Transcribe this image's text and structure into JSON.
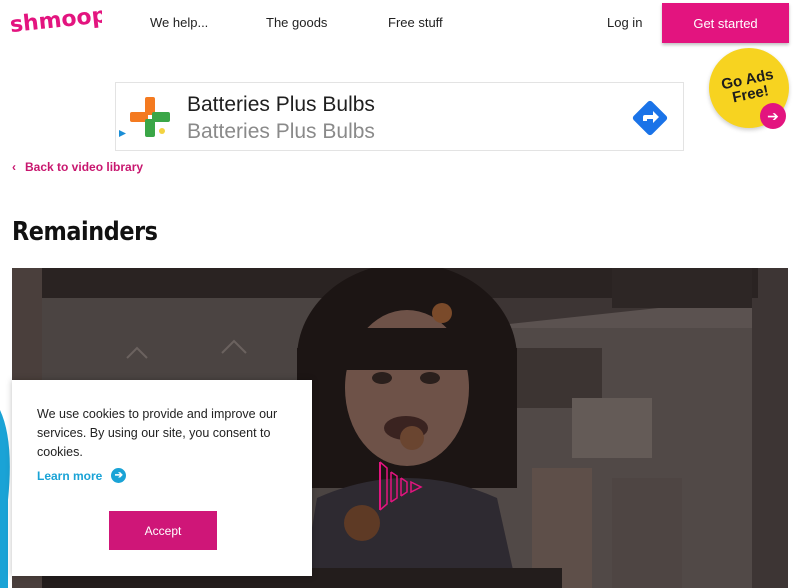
{
  "header": {
    "logo_text": "shmoop",
    "nav": [
      "We help...",
      "The goods",
      "Free stuff"
    ],
    "login_label": "Log in",
    "cta_label": "Get started"
  },
  "ad": {
    "title": "Batteries Plus Bulbs",
    "subtitle": "Batteries Plus Bulbs",
    "icons": [
      "batteries-plus-logo-icon",
      "directions-arrow-icon",
      "adchoices-icon"
    ]
  },
  "ads_free": {
    "label": "Go Ads Free!"
  },
  "back_link": {
    "label": "Back to video library"
  },
  "page": {
    "title": "Remainders"
  },
  "cookie": {
    "message": "We use cookies to provide and improve our services. By using our site, you consent to cookies.",
    "learn_more": "Learn more",
    "accept": "Accept"
  },
  "colors": {
    "brand_pink": "#e3147f",
    "badge_yellow": "#f7d320",
    "link_blue": "#1aa3d6"
  }
}
